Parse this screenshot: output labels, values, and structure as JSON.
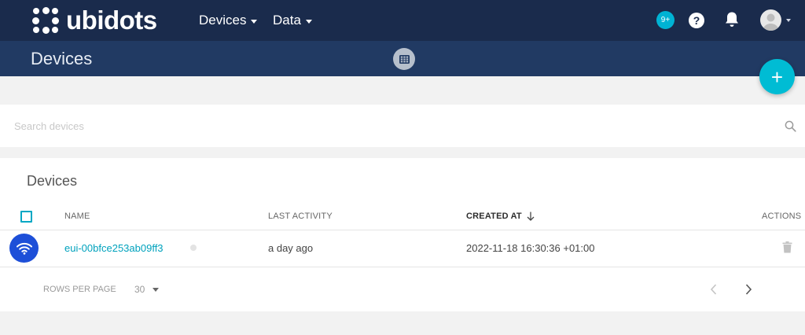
{
  "app": {
    "logo_text": "ubidots",
    "brand_color": "#1a2b4c",
    "accent_color": "#00bcd4"
  },
  "topnav": {
    "menus": [
      {
        "label": "Devices"
      },
      {
        "label": "Data"
      }
    ],
    "notification_badge": "9+",
    "help_glyph": "?"
  },
  "subheader": {
    "title": "Devices",
    "fab_label": "+"
  },
  "search": {
    "placeholder": "Search devices",
    "value": ""
  },
  "devices_table": {
    "title": "Devices",
    "columns": {
      "name": "NAME",
      "last_activity": "LAST ACTIVITY",
      "created_at": "CREATED AT",
      "actions": "ACTIONS"
    },
    "sort_column": "created_at",
    "sort_direction": "descending",
    "rows": [
      {
        "name": "eui-00bfce253ab09ff3",
        "icon": "wifi-icon",
        "last_activity": "a day ago",
        "created_at": "2022-11-18 16:30:36 +01:00"
      }
    ],
    "pagination": {
      "rows_per_page_label": "ROWS PER PAGE",
      "rows_per_page_value": "30"
    }
  }
}
